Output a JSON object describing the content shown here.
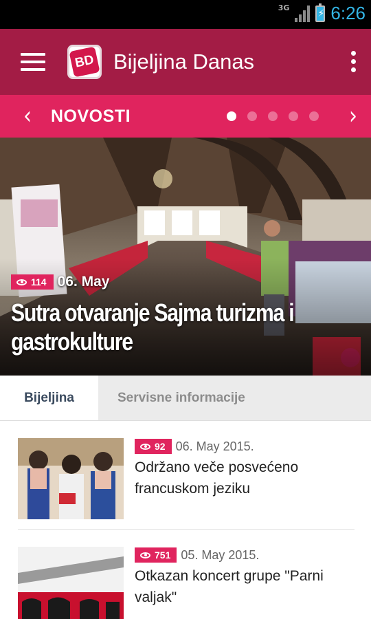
{
  "status_bar": {
    "network": "3G",
    "time": "6:26"
  },
  "app_bar": {
    "logo_text": "BD",
    "title": "Bijeljina Danas"
  },
  "category_bar": {
    "title": "NOVOSTI",
    "page_count": 5,
    "active_page": 1
  },
  "hero": {
    "views": "114",
    "date": "06. May",
    "title": "Sutra otvaranje Sajma turizma i gastrokulture"
  },
  "tabs": [
    {
      "label": "Bijeljina"
    },
    {
      "label": "Servisne informacije"
    }
  ],
  "news": [
    {
      "views": "92",
      "date": "06. May 2015.",
      "title": "Održano veče posvećeno francuskom jeziku"
    },
    {
      "views": "751",
      "date": "05. May 2015.",
      "title": "Otkazan koncert grupe \"Parni valjak\""
    }
  ],
  "colors": {
    "app_bar": "#a31c45",
    "accent": "#e0245e",
    "status_time": "#33b5e5"
  }
}
